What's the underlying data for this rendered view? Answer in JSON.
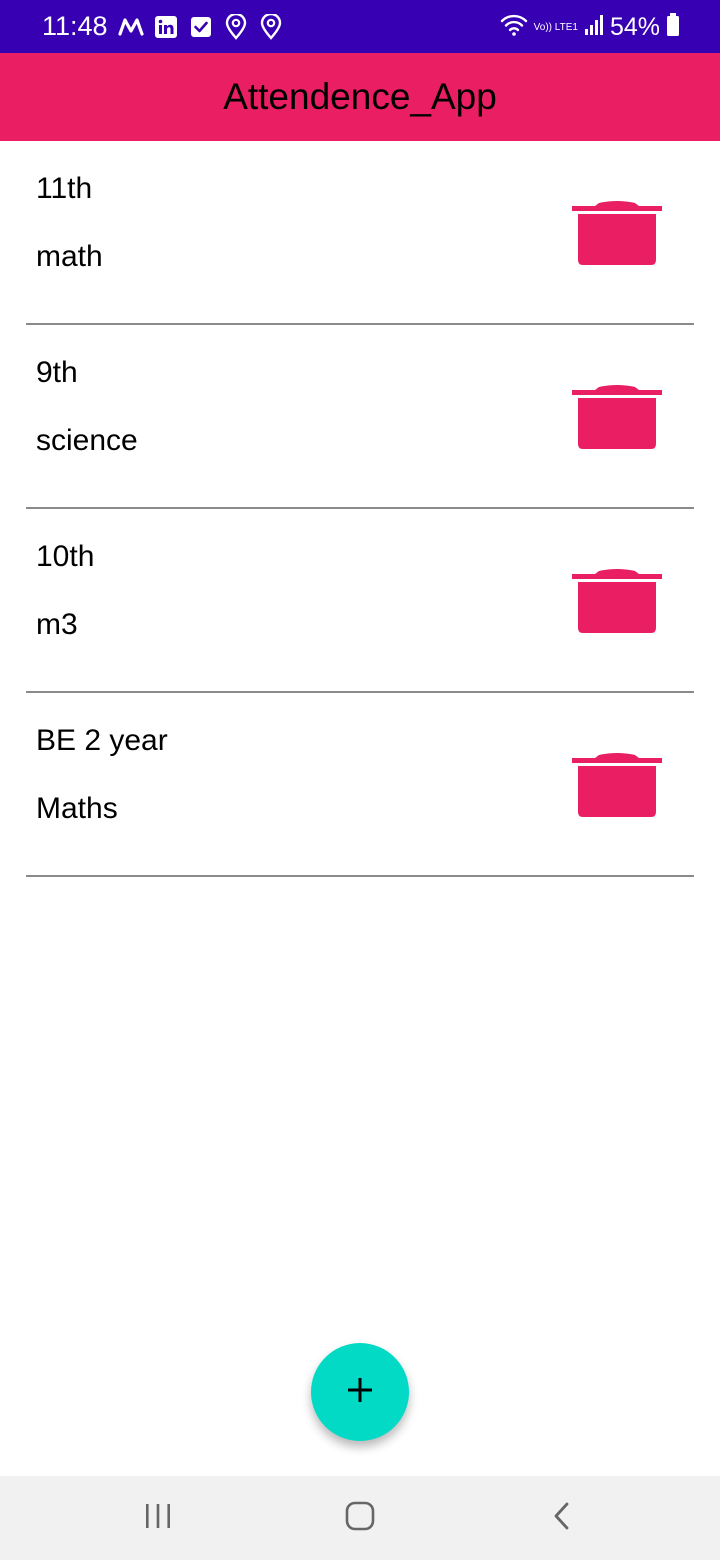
{
  "status_bar": {
    "time": "11:48",
    "battery": "54%",
    "network_label": "Vo)) LTE1",
    "left_icons": [
      "m-icon",
      "linkedin-icon",
      "checkbox-icon",
      "location-pin-icon",
      "location-pin-icon"
    ],
    "right_icons": [
      "wifi-icon",
      "lte-icon",
      "signal-icon",
      "battery-icon"
    ]
  },
  "app_bar": {
    "title": "Attendence_App"
  },
  "list": {
    "items": [
      {
        "line1": "11th",
        "line2": "math"
      },
      {
        "line1": "9th",
        "line2": "science"
      },
      {
        "line1": "10th",
        "line2": "m3"
      },
      {
        "line1": "BE 2 year",
        "line2": "Maths"
      }
    ],
    "delete_icon": "delete-icon"
  },
  "fab": {
    "icon": "plus-icon"
  },
  "nav_bar": {
    "icons": [
      "recent-apps-icon",
      "home-icon",
      "back-icon"
    ]
  },
  "colors": {
    "status_bar": "#3700b3",
    "app_bar": "#e91e63",
    "delete_icon": "#e91e63",
    "fab": "#03dac5",
    "divider": "#8a8a8a",
    "nav_bar": "#f1f1f1"
  }
}
